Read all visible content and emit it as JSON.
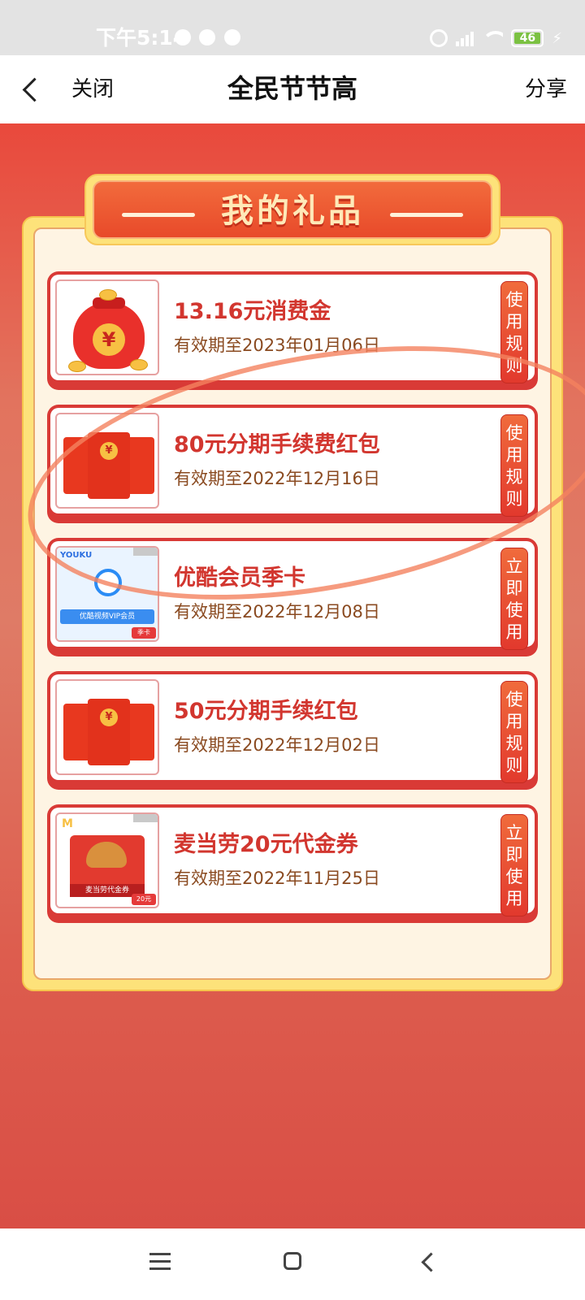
{
  "status_bar": {
    "time": "下午5:14",
    "battery": "46"
  },
  "nav": {
    "close": "关闭",
    "title": "全民节节高",
    "share": "分享"
  },
  "section": {
    "title": "我的礼品"
  },
  "gifts": [
    {
      "title": "13.16元消费金",
      "expiry": "有效期至2023年01月06日",
      "action": "使用规则",
      "icon": "money-bag-icon"
    },
    {
      "title": "80元分期手续费红包",
      "expiry": "有效期至2022年12月16日",
      "action": "使用规则",
      "icon": "red-envelope-icon"
    },
    {
      "title": "优酷会员季卡",
      "expiry": "有效期至2022年12月08日",
      "action": "立即使用",
      "icon": "youku-card-icon",
      "thumb_text": "优酷视频VIP会员",
      "thumb_tag": "季卡",
      "thumb_logo": "YOUKU"
    },
    {
      "title": "50元分期手续红包",
      "expiry": "有效期至2022年12月02日",
      "action": "使用规则",
      "icon": "red-envelope-icon"
    },
    {
      "title": "麦当劳20元代金券",
      "expiry": "有效期至2022年11月25日",
      "action": "立即使用",
      "icon": "mcdonalds-voucher-icon",
      "thumb_text": "麦当劳代金券",
      "thumb_tag": "20元"
    }
  ],
  "colors": {
    "accent": "#d93a36",
    "title_text": "#d2362f",
    "expiry_text": "#8a4a20",
    "panel": "#fef4e3"
  }
}
